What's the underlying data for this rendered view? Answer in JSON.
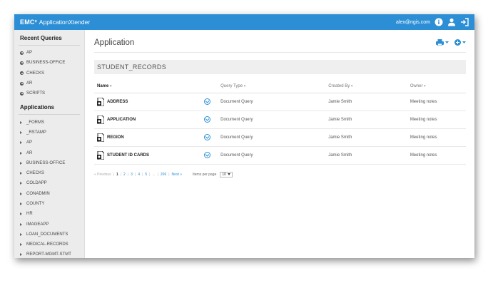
{
  "brand": {
    "company": "EMC²",
    "product": "ApplicationXtender"
  },
  "header": {
    "user": "alex@ngis.com",
    "icons": [
      "info-icon",
      "user-icon",
      "logout-icon"
    ]
  },
  "sidebar": {
    "recent_title": "Recent Queries",
    "recent": [
      {
        "label": "AP"
      },
      {
        "label": "BUSINESS-OFFICE"
      },
      {
        "label": "CHECKS"
      },
      {
        "label": "AR"
      },
      {
        "label": "SCRIPTS"
      }
    ],
    "apps_title": "Applications",
    "apps": [
      {
        "label": "_FORMS"
      },
      {
        "label": "_RSTAMP"
      },
      {
        "label": "AP"
      },
      {
        "label": "AR"
      },
      {
        "label": "BUSINESS-OFFICE"
      },
      {
        "label": "CHECKS"
      },
      {
        "label": "COLDAPP"
      },
      {
        "label": "CONADMIN"
      },
      {
        "label": "COUNTY"
      },
      {
        "label": "HR"
      },
      {
        "label": "IMAGEAPP"
      },
      {
        "label": "LOAN_DOCUMENTS"
      },
      {
        "label": "MEDICAL-RECORDS"
      },
      {
        "label": "REPORT-MGMT-STMT"
      }
    ]
  },
  "main": {
    "title": "Application",
    "section": "STUDENT_RECORDS",
    "columns": {
      "name": "Name",
      "query_type": "Query Type",
      "created_by": "Created By",
      "owner": "Owner"
    },
    "rows": [
      {
        "name": "ADDRESS",
        "query_type": "Document Query",
        "created_by": "Jamie Smith",
        "owner": "Meeting notes"
      },
      {
        "name": "APPLICATION",
        "query_type": "Document Query",
        "created_by": "Jamie Smith",
        "owner": "Meeting notes"
      },
      {
        "name": "REGION",
        "query_type": "Document Query",
        "created_by": "Jamie Smith",
        "owner": "Meeting notes"
      },
      {
        "name": "STUDENT ID CARDS",
        "query_type": "Document Query",
        "created_by": "Jamie Smith",
        "owner": "Meeting notes"
      }
    ],
    "pager": {
      "prev": "« Previous",
      "pages": [
        "1",
        "2",
        "3",
        "4",
        "5",
        "...",
        "206"
      ],
      "next": "Next »",
      "items_label": "Items per page",
      "items_value": "10"
    }
  },
  "colors": {
    "accent": "#2c8fd6",
    "sidebar_bg": "#ececec"
  }
}
